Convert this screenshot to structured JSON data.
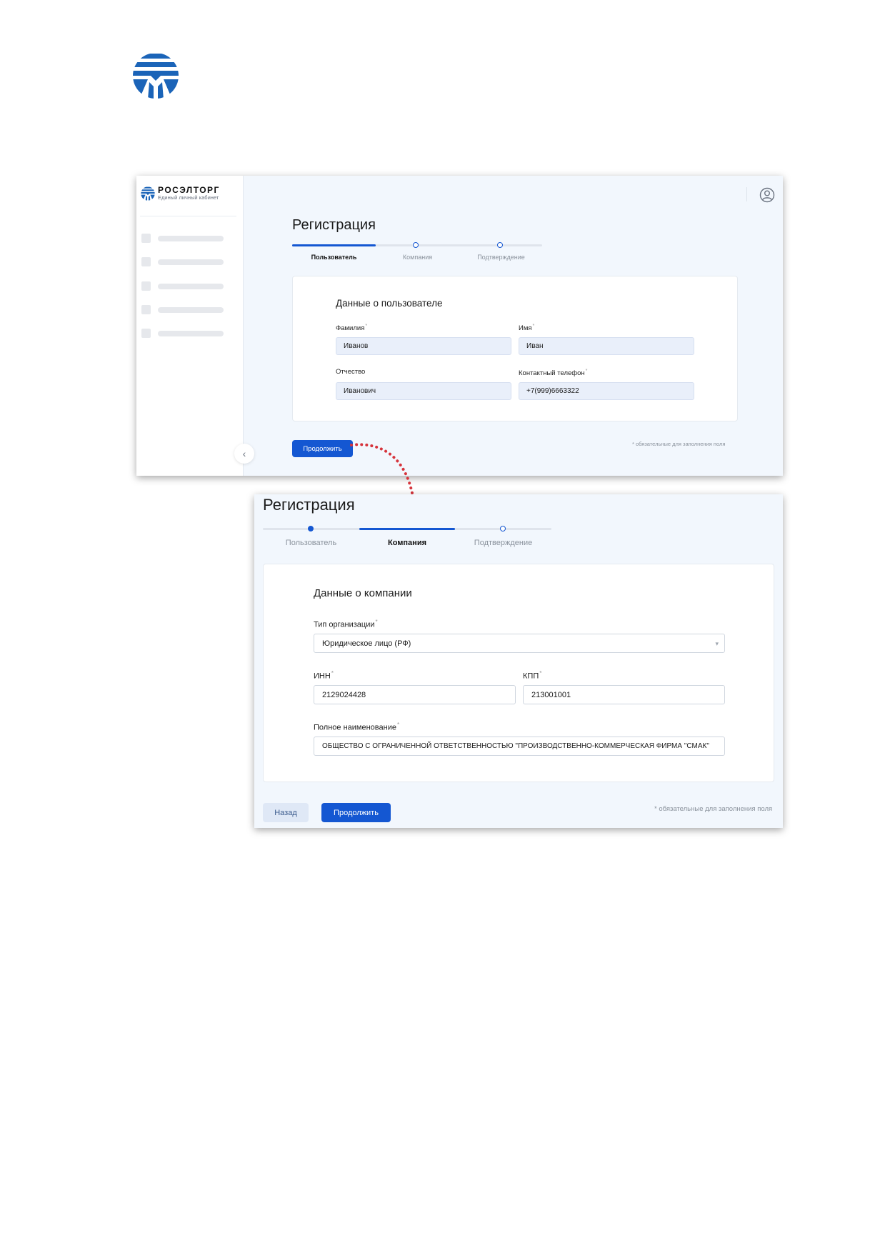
{
  "colors": {
    "primary": "#1457d2",
    "accent_red": "#d6343c",
    "bg": "#f2f7fd"
  },
  "page_logo": {
    "icon": "roseltorg-logo-icon"
  },
  "screen1": {
    "brand": {
      "name": "РОСЭЛТОРГ",
      "subtitle": "Единый личный кабинет"
    },
    "title": "Регистрация",
    "steps": [
      {
        "label": "Пользователь",
        "state": "active"
      },
      {
        "label": "Компания",
        "state": "pending"
      },
      {
        "label": "Подтверждение",
        "state": "pending"
      }
    ],
    "card_title": "Данные о пользователе",
    "fields": {
      "last_name": {
        "label": "Фамилия",
        "value": "Иванов"
      },
      "first_name": {
        "label": "Имя",
        "value": "Иван"
      },
      "middle_name": {
        "label": "Отчество",
        "value": "Иванович"
      },
      "phone": {
        "label": "Контактный телефон",
        "value": "+7(999)6663322"
      }
    },
    "continue_label": "Продолжить",
    "required_note": "* обязательные для заполнения поля"
  },
  "screen2": {
    "title": "Регистрация",
    "steps": [
      {
        "label": "Пользователь",
        "state": "done"
      },
      {
        "label": "Компания",
        "state": "active"
      },
      {
        "label": "Подтверждение",
        "state": "pending"
      }
    ],
    "card_title": "Данные о компании",
    "fields": {
      "org_type": {
        "label": "Тип организации",
        "value": "Юридическое лицо (РФ)"
      },
      "inn": {
        "label": "ИНН",
        "value": "2129024428"
      },
      "kpp": {
        "label": "КПП",
        "value": "213001001"
      },
      "full_name": {
        "label": "Полное наименование",
        "value": "ОБЩЕСТВО С ОГРАНИЧЕННОЙ ОТВЕТСТВЕННОСТЬЮ \"ПРОИЗВОДСТВЕННО-КОММЕРЧЕСКАЯ ФИРМА \"СМАК\""
      }
    },
    "back_label": "Назад",
    "continue_label": "Продолжить",
    "required_note": "* обязательные для заполнения поля"
  }
}
